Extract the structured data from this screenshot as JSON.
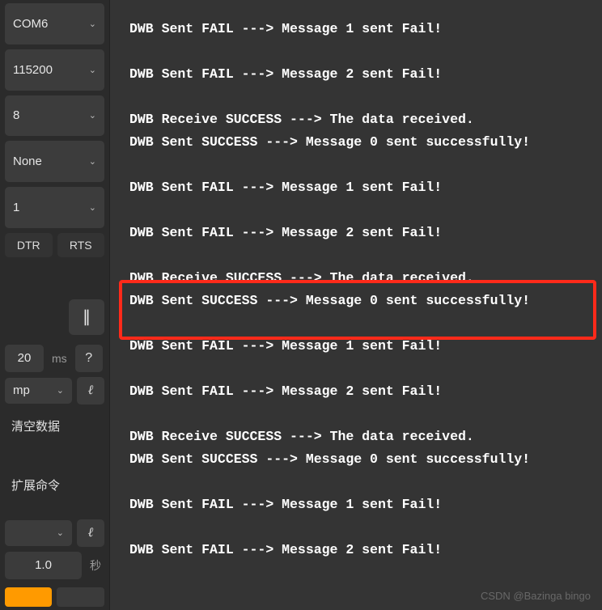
{
  "sidebar": {
    "port": "COM6",
    "baud": "115200",
    "databits": "8",
    "parity": "None",
    "stopbits": "1",
    "dtr": "DTR",
    "rts": "RTS",
    "interval_value": "20",
    "interval_unit": "ms",
    "help": "?",
    "encoding": "mp",
    "clear_data": "清空数据",
    "ext_cmd": "扩展命令",
    "period_value": "1.0",
    "period_unit": "秒"
  },
  "log_lines": [
    "DWB Sent FAIL ---> Message 1 sent Fail!",
    "",
    "DWB Sent FAIL ---> Message 2 sent Fail!",
    "",
    "DWB Receive SUCCESS ---> The data received.",
    "DWB Sent SUCCESS ---> Message 0 sent successfully!",
    "",
    "DWB Sent FAIL ---> Message 1 sent Fail!",
    "",
    "DWB Sent FAIL ---> Message 2 sent Fail!",
    "",
    "DWB Receive SUCCESS ---> The data received.",
    "DWB Sent SUCCESS ---> Message 0 sent successfully!",
    "",
    "DWB Sent FAIL ---> Message 1 sent Fail!",
    "",
    "DWB Sent FAIL ---> Message 2 sent Fail!",
    "",
    "DWB Receive SUCCESS ---> The data received.",
    "DWB Sent SUCCESS ---> Message 0 sent successfully!",
    "",
    "DWB Sent FAIL ---> Message 1 sent Fail!",
    "",
    "DWB Sent FAIL ---> Message 2 sent Fail!"
  ],
  "watermark": "CSDN @Bazinga bingo"
}
